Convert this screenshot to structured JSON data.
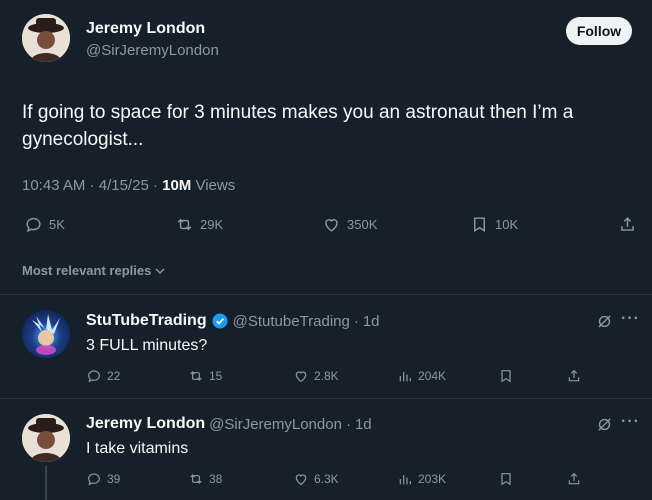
{
  "tweet": {
    "author_name": "Jeremy London",
    "author_handle": "@SirJeremyLondon",
    "follow_label": "Follow",
    "text": "If going to space for 3 minutes makes you an astronaut then I’m a gynecologist...",
    "time": "10:43 AM",
    "date": "4/15/25",
    "views_count": "10M",
    "views_label": "Views",
    "sep": "·",
    "replies": "5K",
    "reposts": "29K",
    "likes": "350K",
    "bookmarks": "10K"
  },
  "sort_label": "Most relevant replies",
  "replies": [
    {
      "name": "StuTubeTrading",
      "handle": "@StutubeTrading",
      "age": "1d",
      "sep": "·",
      "text": "3 FULL minutes?",
      "replies": "22",
      "reposts": "15",
      "likes": "2.8K",
      "views": "204K",
      "verified": true
    },
    {
      "name": "Jeremy London",
      "handle": "@SirJeremyLondon",
      "age": "1d",
      "sep": "·",
      "text": "I take vitamins",
      "replies": "39",
      "reposts": "38",
      "likes": "6.3K",
      "views": "203K",
      "verified": false
    }
  ],
  "colors": {
    "background": "#15202b",
    "muted": "#8b98a5",
    "verified": "#1d9bf0",
    "follow_bg": "#eff3f4"
  },
  "icons": [
    "reply-icon",
    "repost-icon",
    "like-icon",
    "bookmark-icon",
    "share-icon",
    "views-icon",
    "grok-icon",
    "more-icon",
    "verified-badge-icon",
    "chevron-down-icon"
  ]
}
